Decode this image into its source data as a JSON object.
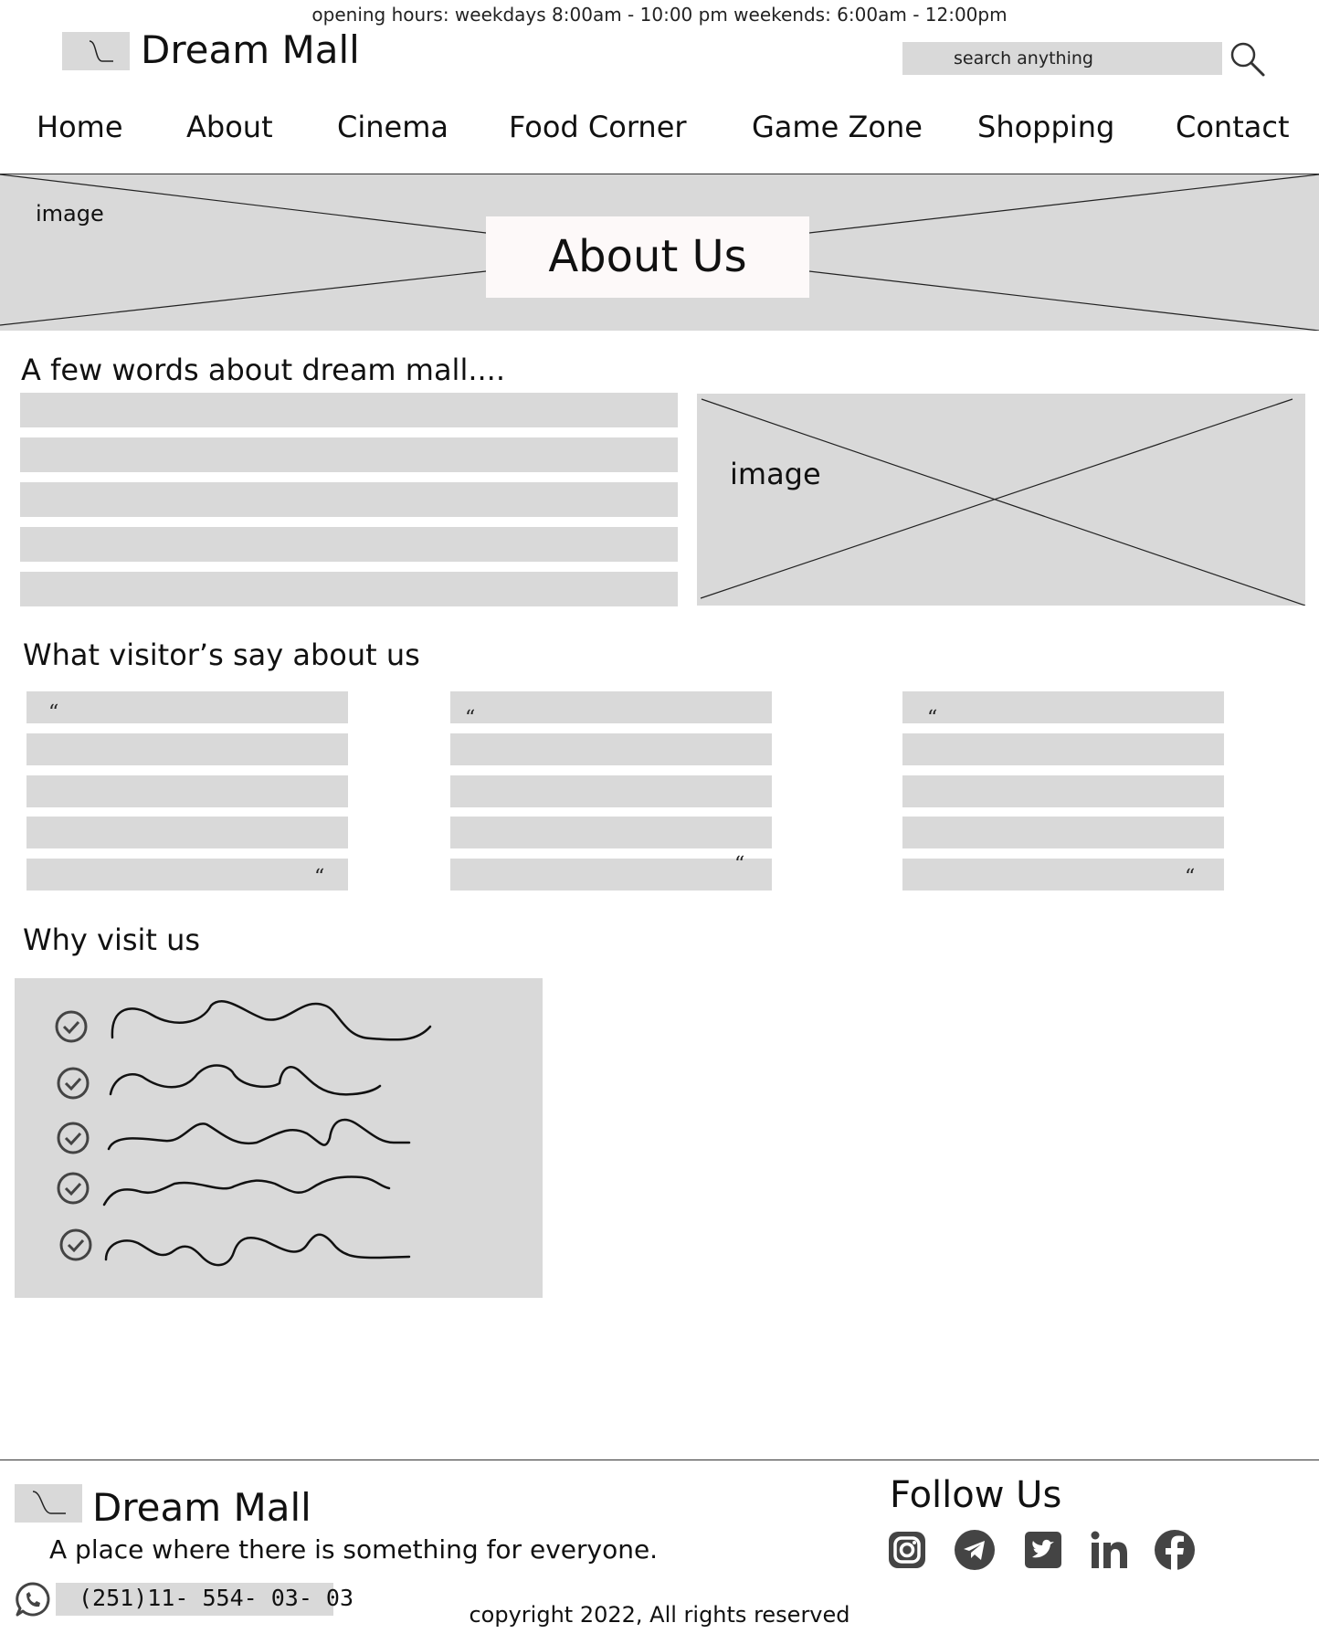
{
  "header": {
    "opening_hours": "opening hours: weekdays 8:00am - 10:00 pm  weekends: 6:00am - 12:00pm",
    "brand": "Dream Mall",
    "search_placeholder": "search anything"
  },
  "nav": {
    "items": [
      "Home",
      "About",
      "Cinema",
      "Food Corner",
      "Game Zone",
      "Shopping",
      "Contact"
    ]
  },
  "hero": {
    "image_label": "image",
    "title": "About Us"
  },
  "about": {
    "heading": "A few words about dream mall....",
    "image_label": "image"
  },
  "testimonials": {
    "heading": "What visitor’s say about us",
    "quote_mark": "“"
  },
  "why_visit": {
    "heading": "Why visit us",
    "icon": "check-circle-icon"
  },
  "footer": {
    "brand": "Dream Mall",
    "tagline": "A place where there is something for everyone.",
    "phone": "(251)11- 554- 03- 03",
    "copyright": "copyright 2022, All rights reserved",
    "follow_heading": "Follow Us",
    "social_icons": [
      "instagram-icon",
      "telegram-icon",
      "twitter-icon",
      "linkedin-icon",
      "facebook-icon"
    ]
  },
  "colors": {
    "placeholder_gray": "#d9d9d9",
    "icon_gray": "#444444",
    "title_box": "#fdf9f9"
  }
}
